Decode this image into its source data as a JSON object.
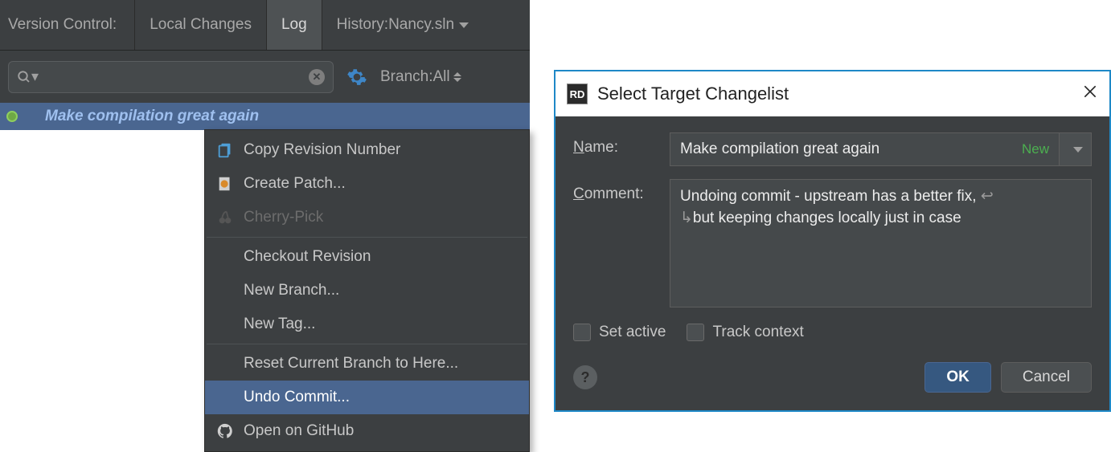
{
  "vc": {
    "title": "Version Control:",
    "tabs": {
      "local": "Local Changes",
      "log": "Log",
      "history_prefix": "History: ",
      "history_value": "Nancy.sln"
    },
    "branch_filter_label": "Branch: ",
    "branch_filter_value": "All",
    "commit_message": "Make compilation great again"
  },
  "context_menu": {
    "copy_revision": "Copy Revision Number",
    "create_patch": "Create Patch...",
    "cherry_pick": "Cherry-Pick",
    "checkout_revision": "Checkout Revision",
    "new_branch": "New Branch...",
    "new_tag": "New Tag...",
    "reset_branch": "Reset Current Branch to Here...",
    "undo_commit": "Undo Commit...",
    "open_github": "Open on GitHub"
  },
  "dialog": {
    "title": "Select Target Changelist",
    "logo": "RD",
    "name_label": "Name:",
    "name_value": "Make compilation great again",
    "new_badge": "New",
    "comment_label": "Comment:",
    "comment_value_line1": "Undoing commit - upstream has a better fix,",
    "comment_value_line2": "but keeping changes locally just in case",
    "set_active": "Set active",
    "track_context": "Track context",
    "ok": "OK",
    "cancel": "Cancel"
  }
}
